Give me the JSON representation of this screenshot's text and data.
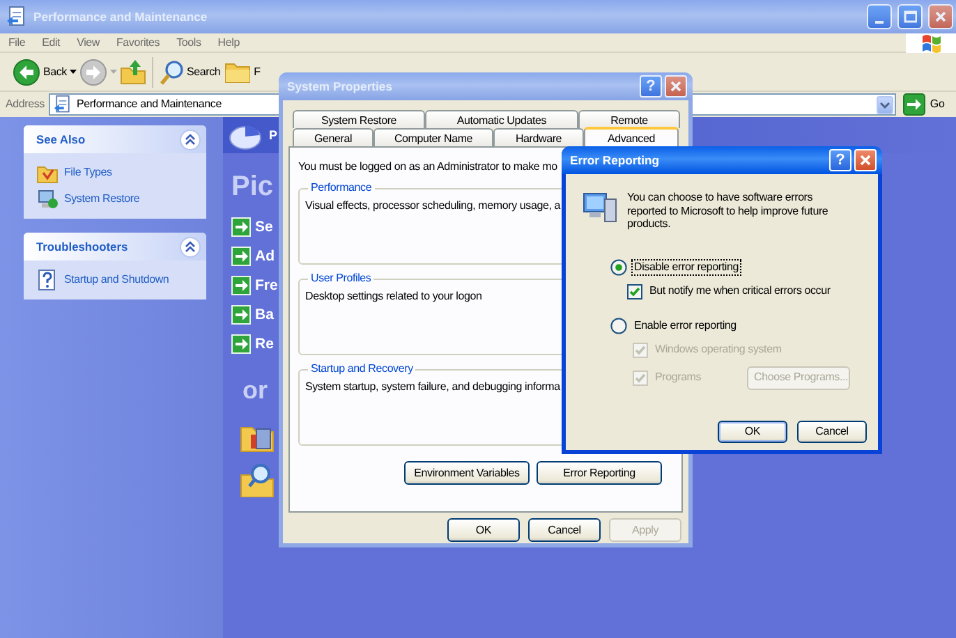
{
  "explorer": {
    "title": "Performance and Maintenance",
    "active": false,
    "menu": [
      "File",
      "Edit",
      "View",
      "Favorites",
      "Tools",
      "Help"
    ],
    "toolbar": {
      "back": "Back",
      "search": "Search",
      "folders": "F"
    },
    "address": {
      "label": "Address",
      "value": "Performance and Maintenance",
      "go": "Go"
    },
    "side_panels": [
      {
        "title": "See Also",
        "expanded": true,
        "items": [
          {
            "kind": "file-types",
            "label": "File Types"
          },
          {
            "kind": "system-restore",
            "label": "System Restore"
          }
        ]
      },
      {
        "title": "Troubleshooters",
        "expanded": true,
        "items": [
          {
            "kind": "help",
            "label": "Startup and Shutdown"
          }
        ]
      }
    ],
    "content": {
      "header": "P",
      "heading": "Pic",
      "tasks": [
        "Se",
        "Ad",
        "Fre",
        "Ba",
        "Re"
      ],
      "or": "or"
    }
  },
  "system_properties": {
    "title": "System Properties",
    "active": false,
    "help": "?",
    "tab_rows": [
      [
        {
          "label": "System Restore",
          "selected": false
        },
        {
          "label": "Automatic Updates",
          "selected": false
        },
        {
          "label": "Remote",
          "selected": false
        }
      ],
      [
        {
          "label": "General",
          "selected": false
        },
        {
          "label": "Computer Name",
          "selected": false
        },
        {
          "label": "Hardware",
          "selected": false
        },
        {
          "label": "Advanced",
          "selected": true
        }
      ]
    ],
    "notice": "You must be logged on as an Administrator to make mo",
    "groups": [
      {
        "title": "Performance",
        "text": "Visual effects, processor scheduling, memory usage, a"
      },
      {
        "title": "User Profiles",
        "text": "Desktop settings related to your logon"
      },
      {
        "title": "Startup and Recovery",
        "text": "System startup, system failure, and debugging informa"
      }
    ],
    "buttons": [
      "Environment Variables",
      "Error Reporting"
    ],
    "footer": [
      {
        "label": "OK",
        "disabled": false
      },
      {
        "label": "Cancel",
        "disabled": false
      },
      {
        "label": "Apply",
        "disabled": true
      }
    ]
  },
  "error_reporting": {
    "title": "Error Reporting",
    "active": true,
    "help": "?",
    "intro": "You can choose to have software errors reported to Microsoft to help improve future products.",
    "options": [
      {
        "kind": "radio",
        "label": "Disable error reporting",
        "selected": true,
        "disabled": false,
        "focused": true
      },
      {
        "kind": "checkbox",
        "label": "But notify me when critical errors occur",
        "checked": true,
        "disabled": false,
        "focused": false
      },
      {
        "kind": "radio",
        "label": "Enable error reporting",
        "selected": false,
        "disabled": false,
        "focused": false
      },
      {
        "kind": "checkbox",
        "label": "Windows operating system",
        "checked": true,
        "disabled": true,
        "focused": false
      },
      {
        "kind": "checkbox",
        "label": "Programs",
        "checked": true,
        "disabled": true,
        "focused": false,
        "button": {
          "label": "Choose Programs...",
          "disabled": true
        }
      }
    ],
    "buttons": [
      {
        "label": "OK",
        "default": true
      },
      {
        "label": "Cancel",
        "default": false
      }
    ]
  }
}
